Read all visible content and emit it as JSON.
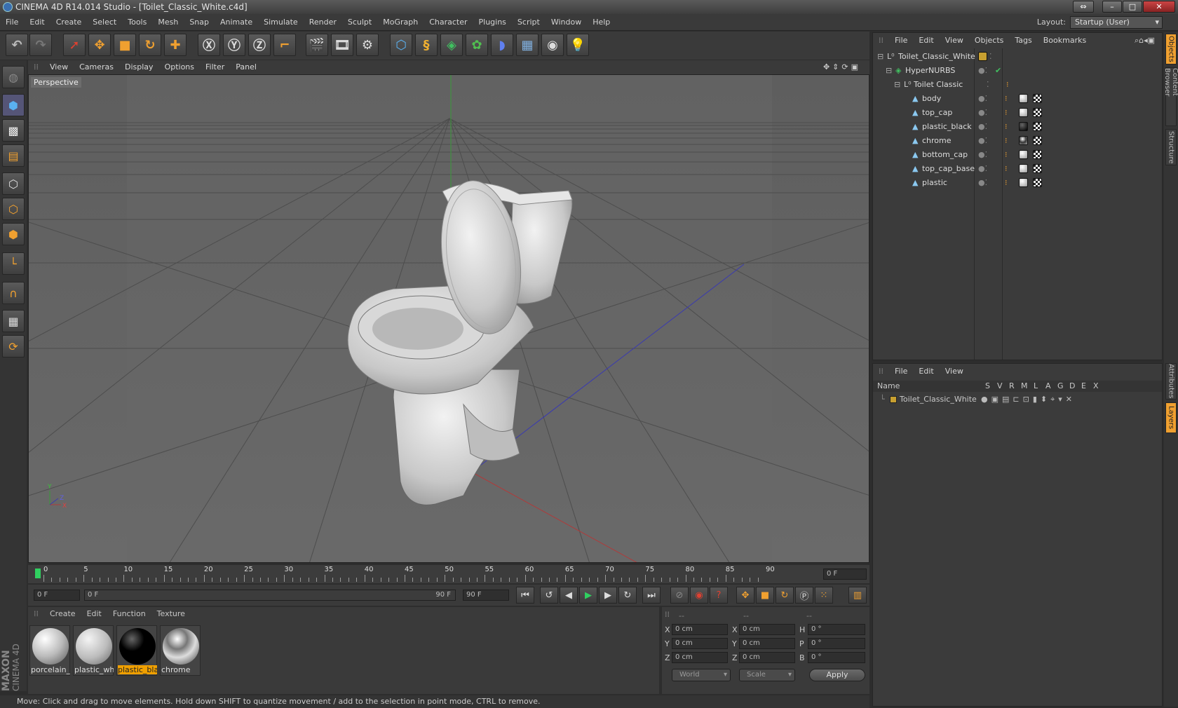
{
  "window": {
    "title": "CINEMA 4D R14.014 Studio - [Toilet_Classic_White.c4d]"
  },
  "menubar": {
    "items": [
      "File",
      "Edit",
      "Create",
      "Select",
      "Tools",
      "Mesh",
      "Snap",
      "Animate",
      "Simulate",
      "Render",
      "Sculpt",
      "MoGraph",
      "Character",
      "Plugins",
      "Script",
      "Window",
      "Help"
    ]
  },
  "layout": {
    "label": "Layout:",
    "value": "Startup (User)"
  },
  "viewport": {
    "menu": [
      "View",
      "Cameras",
      "Display",
      "Options",
      "Filter",
      "Panel"
    ],
    "label": "Perspective",
    "axis_labels": {
      "x": "X",
      "y": "Y",
      "z": "Z"
    }
  },
  "timeline": {
    "ticks": [
      "0",
      "5",
      "10",
      "15",
      "20",
      "25",
      "30",
      "35",
      "40",
      "45",
      "50",
      "55",
      "60",
      "65",
      "70",
      "75",
      "80",
      "85",
      "90"
    ],
    "current_frame": "0 F"
  },
  "transport": {
    "start": "0 F",
    "range_left": "0 F",
    "range_right": "90 F",
    "end": "90 F"
  },
  "materials": {
    "menu": [
      "Create",
      "Edit",
      "Function",
      "Texture"
    ],
    "items": [
      {
        "label": "porcelain_w",
        "style": "white"
      },
      {
        "label": "plastic_whi",
        "style": "white"
      },
      {
        "label": "plastic_blac",
        "style": "black",
        "selected": true
      },
      {
        "label": "chrome",
        "style": "chrome"
      }
    ]
  },
  "coords": {
    "headers": [
      "--",
      "--",
      "--"
    ],
    "rows": [
      {
        "a": "X",
        "av": "0 cm",
        "b": "X",
        "bv": "0 cm",
        "c": "H",
        "cv": "0 °"
      },
      {
        "a": "Y",
        "av": "0 cm",
        "b": "Y",
        "bv": "0 cm",
        "c": "P",
        "cv": "0 °"
      },
      {
        "a": "Z",
        "av": "0 cm",
        "b": "Z",
        "bv": "0 cm",
        "c": "B",
        "cv": "0 °"
      }
    ],
    "mode": "World",
    "type": "Scale",
    "apply": "Apply"
  },
  "status": {
    "text": "Move: Click and drag to move elements. Hold down SHIFT to quantize movement / add to the selection in point mode, CTRL to remove."
  },
  "objects": {
    "menu": [
      "File",
      "Edit",
      "View",
      "Objects",
      "Tags",
      "Bookmarks"
    ],
    "tree": [
      {
        "name": "Toilet_Classic_White",
        "indent": 0,
        "kind": "null"
      },
      {
        "name": "HyperNURBS",
        "indent": 1,
        "kind": "nurbs"
      },
      {
        "name": "Toilet Classic",
        "indent": 2,
        "kind": "null"
      },
      {
        "name": "body",
        "indent": 3,
        "kind": "poly",
        "mat": "white"
      },
      {
        "name": "top_cap",
        "indent": 3,
        "kind": "poly",
        "mat": "white"
      },
      {
        "name": "plastic_black",
        "indent": 3,
        "kind": "poly",
        "mat": "black"
      },
      {
        "name": "chrome",
        "indent": 3,
        "kind": "poly",
        "mat": "chrome"
      },
      {
        "name": "bottom_cap",
        "indent": 3,
        "kind": "poly",
        "mat": "white"
      },
      {
        "name": "top_cap_base",
        "indent": 3,
        "kind": "poly",
        "mat": "white"
      },
      {
        "name": "plastic",
        "indent": 3,
        "kind": "poly",
        "mat": "white"
      }
    ]
  },
  "layers": {
    "menu": [
      "File",
      "Edit",
      "View"
    ],
    "columns": [
      "Name",
      "S",
      "V",
      "R",
      "M",
      "L",
      "A",
      "G",
      "D",
      "E",
      "X"
    ],
    "rows": [
      {
        "name": "Toilet_Classic_White",
        "color": "#c8a030"
      }
    ]
  },
  "sidetabs": [
    "Objects",
    "Content Browser",
    "Structure",
    "Attributes",
    "Layers"
  ],
  "brand": {
    "line1": "MAXON",
    "line2": "CINEMA 4D"
  },
  "colors": {
    "accent_orange": "#f0a030",
    "selected_label": "#f0a000",
    "toolbar_bg": "#3a3a3a"
  }
}
